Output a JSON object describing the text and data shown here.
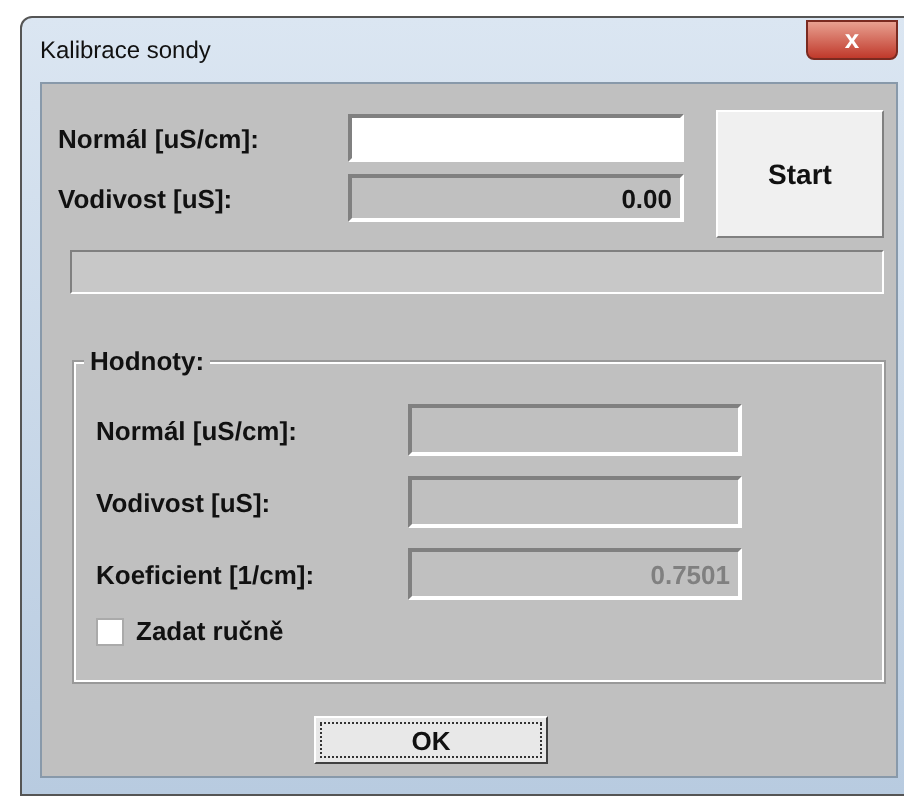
{
  "window": {
    "title": "Kalibrace sondy",
    "close": "x"
  },
  "top_fields": [
    {
      "label": "Normál [uS/cm]:",
      "disabled": false
    },
    {
      "label": "Vodivost [uS]:",
      "value": "0.00",
      "disabled": true
    }
  ],
  "start_button": "Start",
  "progress": {
    "level": 0
  },
  "group": {
    "title": "Hodnoty:",
    "fields": [
      {
        "label": "Normál [uS/cm]:",
        "disabled": true
      },
      {
        "label": "Vodivost [uS]:",
        "disabled": true
      },
      {
        "label": "Koeficient [1/cm]:",
        "value": "0.7501",
        "disabled": true
      }
    ],
    "checkbox": {
      "label": "Zadat ručně",
      "checked": false
    }
  },
  "ok_button": "OK"
}
